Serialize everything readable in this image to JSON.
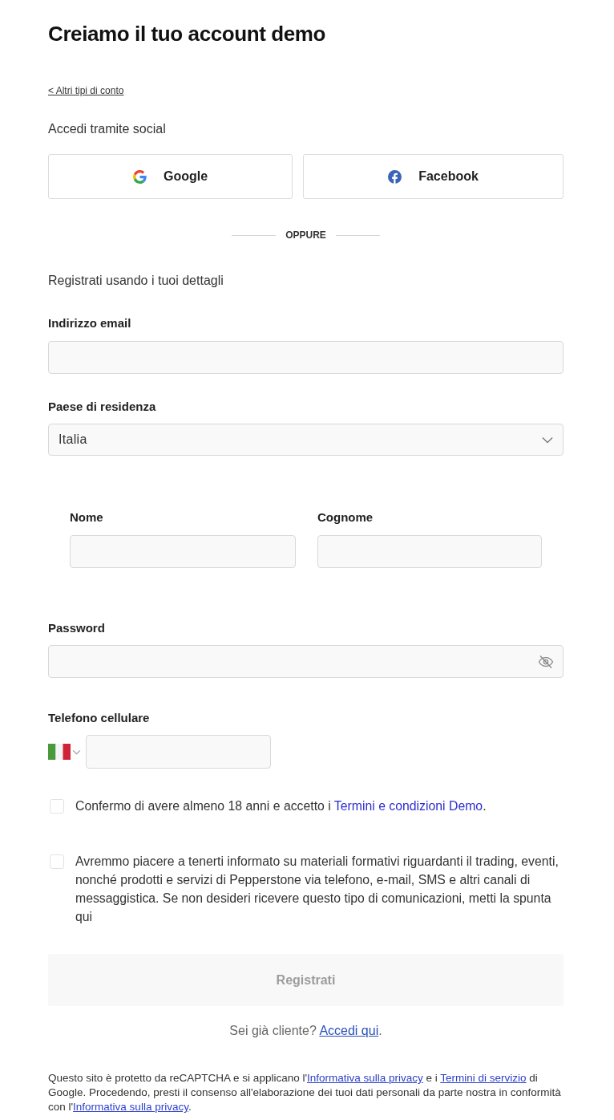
{
  "title": "Creiamo il tuo account demo",
  "back_link": "< Altri tipi di conto",
  "social": {
    "heading": "Accedi tramite social",
    "buttons": [
      {
        "kind": "google",
        "label": "Google"
      },
      {
        "kind": "facebook",
        "label": "Facebook"
      }
    ]
  },
  "divider": "OPPURE",
  "form": {
    "heading": "Registrati usando i tuoi dettagli",
    "email": {
      "label": "Indirizzo email"
    },
    "country": {
      "label": "Paese di residenza",
      "value": "Italia"
    },
    "name_fields": [
      {
        "label": "Nome"
      },
      {
        "label": "Cognome"
      }
    ],
    "password": {
      "label": "Password"
    },
    "phone": {
      "label": "Telefono cellulare"
    },
    "consents": [
      {
        "checked": false,
        "segments": [
          {
            "kind": "text",
            "text": "Confermo di avere almeno 18 anni e accetto i "
          },
          {
            "kind": "link",
            "text": "Termini e condizioni Demo"
          },
          {
            "kind": "text",
            "text": "."
          }
        ]
      },
      {
        "checked": false,
        "segments": [
          {
            "kind": "text",
            "text": "Avremmo piacere a tenerti informato su materiali formativi riguardanti il trading, eventi, nonché prodotti e servizi di Pepperstone via telefono, e-mail, SMS e altri canali di messaggistica. Se non desideri ricevere questo tipo di comunicazioni, metti la spunta qui"
          }
        ]
      }
    ],
    "submit": {
      "label": "Registrati",
      "disabled": true
    }
  },
  "login_prompt": {
    "segments": [
      {
        "kind": "text",
        "text": "Sei già cliente? "
      },
      {
        "kind": "link",
        "text": "Accedi qui"
      },
      {
        "kind": "text",
        "text": "."
      }
    ]
  },
  "legal": {
    "segments": [
      {
        "kind": "text",
        "text": "Questo sito è protetto da reCAPTCHA e si applicano l'"
      },
      {
        "kind": "link",
        "text": "Informativa sulla privacy"
      },
      {
        "kind": "text",
        "text": " e i "
      },
      {
        "kind": "link",
        "text": "Termini di servizio"
      },
      {
        "kind": "text",
        "text": " di Google. Procedendo, presti il consenso all'elaborazione dei tuoi dati personali da parte nostra in conformità con l'"
      },
      {
        "kind": "link",
        "text": "Informativa sulla privacy"
      },
      {
        "kind": "text",
        "text": "."
      }
    ]
  }
}
